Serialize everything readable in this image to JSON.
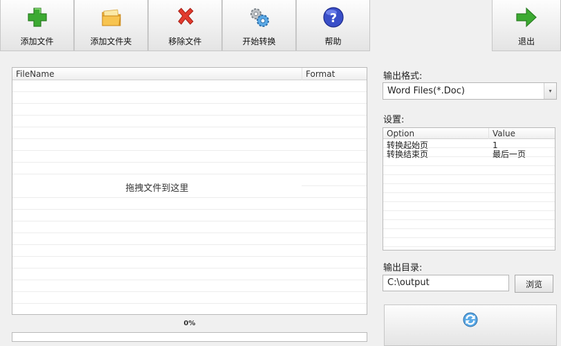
{
  "toolbar": {
    "add_file": "添加文件",
    "add_folder": "添加文件夹",
    "remove_file": "移除文件",
    "start_convert": "开始转换",
    "help": "帮助",
    "exit": "退出"
  },
  "file_list": {
    "col_filename": "FileName",
    "col_format": "Format",
    "drop_hint": "拖拽文件到这里"
  },
  "progress": {
    "label": "0%",
    "value": 0
  },
  "output_format": {
    "label": "输出格式:",
    "selected": "Word Files(*.Doc)"
  },
  "settings": {
    "label": "设置:",
    "col_option": "Option",
    "col_value": "Value",
    "rows": [
      {
        "option": "转换起始页",
        "value": "1"
      },
      {
        "option": "转换结束页",
        "value": "最后一页"
      }
    ]
  },
  "output_dir": {
    "label": "输出目录:",
    "value": "C:\\output",
    "browse": "浏览"
  }
}
